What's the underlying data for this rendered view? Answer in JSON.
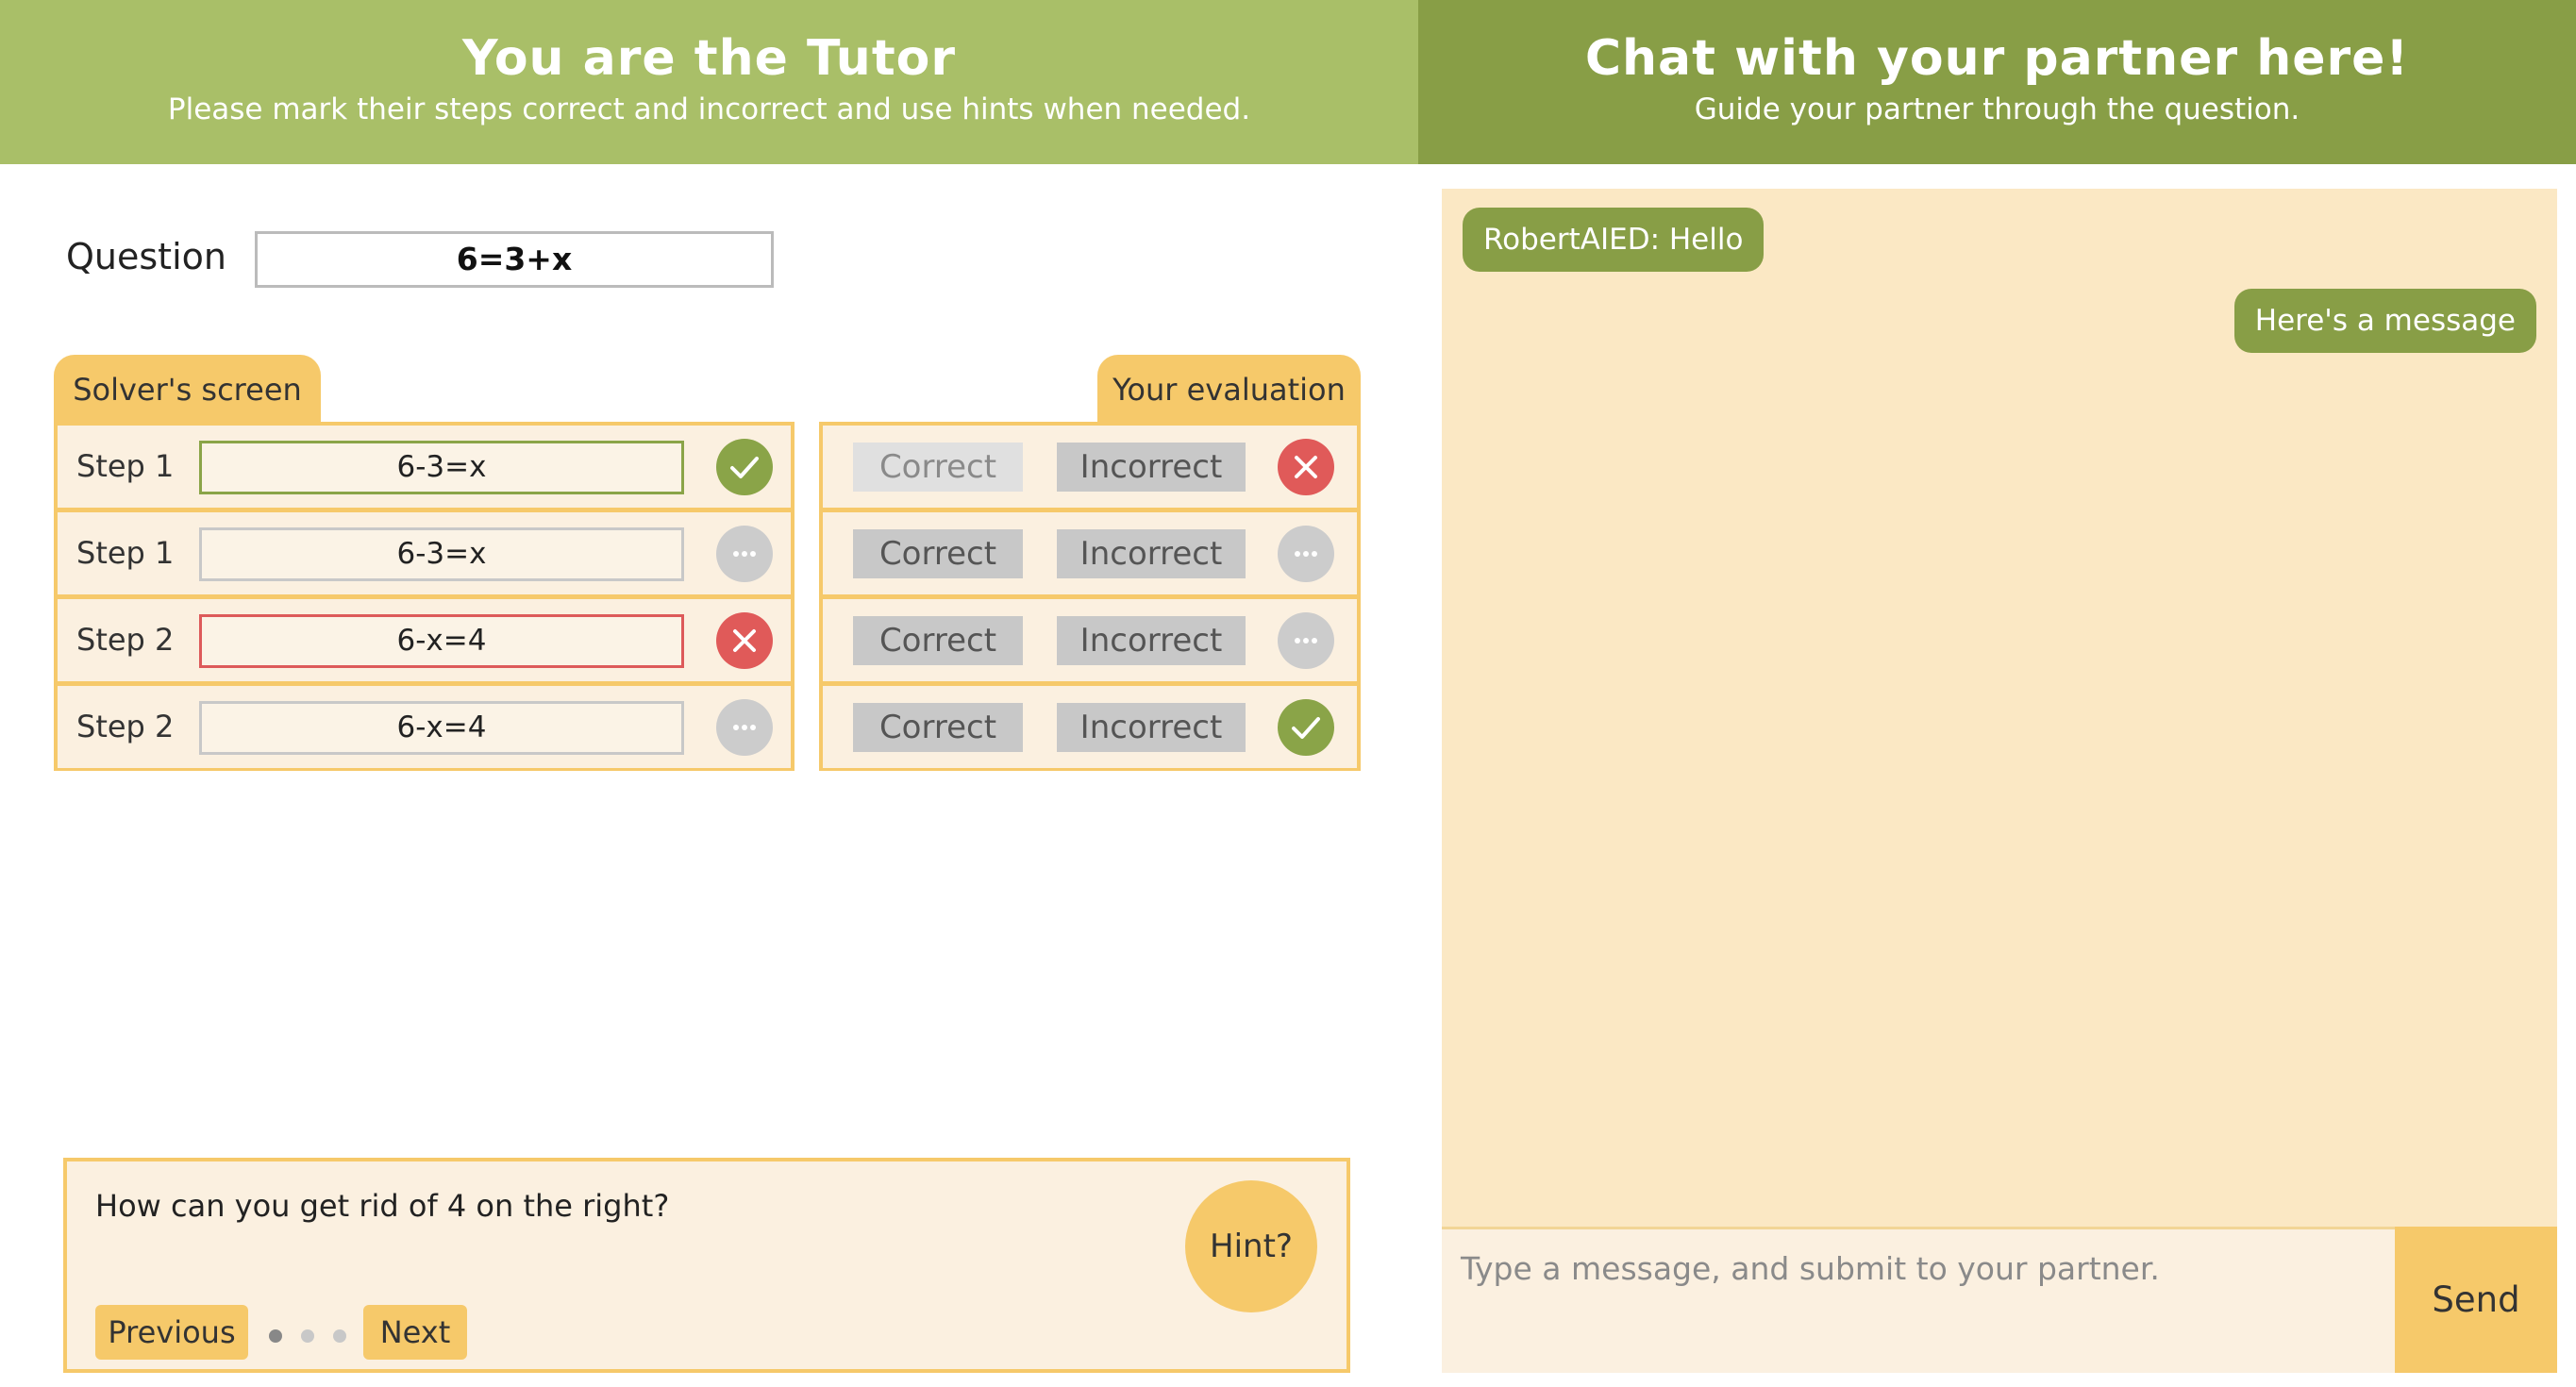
{
  "colors": {
    "header_left_bg": "#a9bf68",
    "header_right_bg": "#889e46",
    "accent_yellow": "#f6c96a",
    "panel_bg": "#fbf0e0",
    "chat_bg": "#fbe8c4",
    "correct_green": "#8aa448",
    "incorrect_red": "#e05a59",
    "pending_gray": "#cccccc"
  },
  "tutor_header": {
    "title": "You are the Tutor",
    "subtitle": "Please mark their steps correct and incorrect and use hints when needed."
  },
  "chat_header": {
    "title": "Chat with your partner here!",
    "subtitle": "Guide your partner through the question."
  },
  "question": {
    "label": "Question",
    "value": "6=3+x"
  },
  "solver": {
    "tab_label": "Solver's screen",
    "steps": [
      {
        "label": "Step 1",
        "value": "6-3=x",
        "status": "correct",
        "status_icon": "check-icon"
      },
      {
        "label": "Step 1",
        "value": "6-3=x",
        "status": "pending",
        "status_icon": "ellipsis-icon"
      },
      {
        "label": "Step 2",
        "value": "6-x=4",
        "status": "incorrect",
        "status_icon": "x-icon"
      },
      {
        "label": "Step 2",
        "value": "6-x=4",
        "status": "pending",
        "status_icon": "ellipsis-icon"
      }
    ]
  },
  "evaluation": {
    "tab_label": "Your evaluation",
    "rows": [
      {
        "correct_label": "Correct",
        "incorrect_label": "Incorrect",
        "status": "incorrect",
        "status_icon": "x-icon"
      },
      {
        "correct_label": "Correct",
        "incorrect_label": "Incorrect",
        "status": "pending",
        "status_icon": "ellipsis-icon"
      },
      {
        "correct_label": "Correct",
        "incorrect_label": "Incorrect",
        "status": "pending",
        "status_icon": "ellipsis-icon"
      },
      {
        "correct_label": "Correct",
        "incorrect_label": "Incorrect",
        "status": "correct",
        "status_icon": "check-icon"
      }
    ]
  },
  "hint": {
    "text": "How can you get rid of 4 on the right?",
    "button_label": "Hint?",
    "previous_label": "Previous",
    "next_label": "Next",
    "page_count": 3,
    "current_page": 1
  },
  "chat": {
    "messages": [
      {
        "text": "RobertAIED: Hello",
        "direction": "incoming"
      },
      {
        "text": "Here's a message",
        "direction": "outgoing"
      }
    ],
    "input_placeholder": "Type a message, and submit to your partner.",
    "send_label": "Send"
  }
}
